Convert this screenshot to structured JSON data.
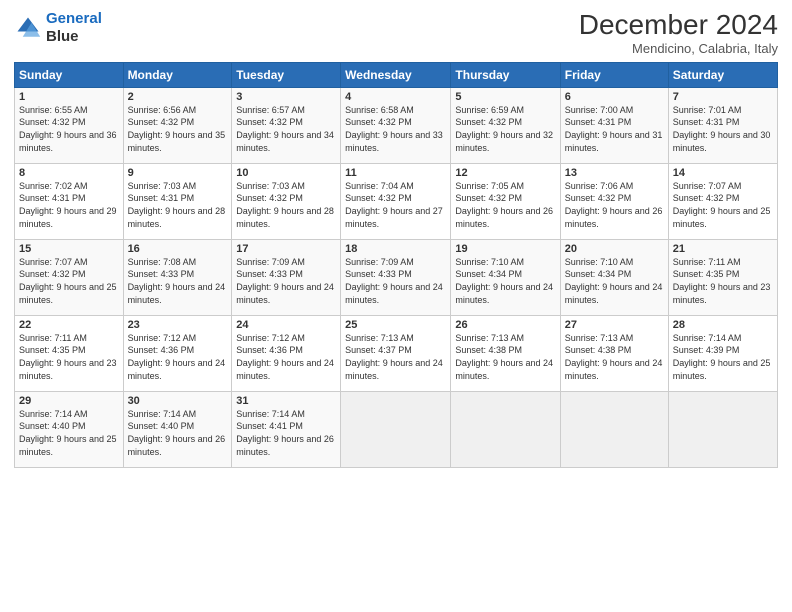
{
  "header": {
    "logo_line1": "General",
    "logo_line2": "Blue",
    "title": "December 2024",
    "subtitle": "Mendicino, Calabria, Italy"
  },
  "weekdays": [
    "Sunday",
    "Monday",
    "Tuesday",
    "Wednesday",
    "Thursday",
    "Friday",
    "Saturday"
  ],
  "weeks": [
    [
      {
        "day": "1",
        "sunrise": "6:55 AM",
        "sunset": "4:32 PM",
        "daylight": "9 hours and 36 minutes."
      },
      {
        "day": "2",
        "sunrise": "6:56 AM",
        "sunset": "4:32 PM",
        "daylight": "9 hours and 35 minutes."
      },
      {
        "day": "3",
        "sunrise": "6:57 AM",
        "sunset": "4:32 PM",
        "daylight": "9 hours and 34 minutes."
      },
      {
        "day": "4",
        "sunrise": "6:58 AM",
        "sunset": "4:32 PM",
        "daylight": "9 hours and 33 minutes."
      },
      {
        "day": "5",
        "sunrise": "6:59 AM",
        "sunset": "4:32 PM",
        "daylight": "9 hours and 32 minutes."
      },
      {
        "day": "6",
        "sunrise": "7:00 AM",
        "sunset": "4:31 PM",
        "daylight": "9 hours and 31 minutes."
      },
      {
        "day": "7",
        "sunrise": "7:01 AM",
        "sunset": "4:31 PM",
        "daylight": "9 hours and 30 minutes."
      }
    ],
    [
      {
        "day": "8",
        "sunrise": "7:02 AM",
        "sunset": "4:31 PM",
        "daylight": "9 hours and 29 minutes."
      },
      {
        "day": "9",
        "sunrise": "7:03 AM",
        "sunset": "4:31 PM",
        "daylight": "9 hours and 28 minutes."
      },
      {
        "day": "10",
        "sunrise": "7:03 AM",
        "sunset": "4:32 PM",
        "daylight": "9 hours and 28 minutes."
      },
      {
        "day": "11",
        "sunrise": "7:04 AM",
        "sunset": "4:32 PM",
        "daylight": "9 hours and 27 minutes."
      },
      {
        "day": "12",
        "sunrise": "7:05 AM",
        "sunset": "4:32 PM",
        "daylight": "9 hours and 26 minutes."
      },
      {
        "day": "13",
        "sunrise": "7:06 AM",
        "sunset": "4:32 PM",
        "daylight": "9 hours and 26 minutes."
      },
      {
        "day": "14",
        "sunrise": "7:07 AM",
        "sunset": "4:32 PM",
        "daylight": "9 hours and 25 minutes."
      }
    ],
    [
      {
        "day": "15",
        "sunrise": "7:07 AM",
        "sunset": "4:32 PM",
        "daylight": "9 hours and 25 minutes."
      },
      {
        "day": "16",
        "sunrise": "7:08 AM",
        "sunset": "4:33 PM",
        "daylight": "9 hours and 24 minutes."
      },
      {
        "day": "17",
        "sunrise": "7:09 AM",
        "sunset": "4:33 PM",
        "daylight": "9 hours and 24 minutes."
      },
      {
        "day": "18",
        "sunrise": "7:09 AM",
        "sunset": "4:33 PM",
        "daylight": "9 hours and 24 minutes."
      },
      {
        "day": "19",
        "sunrise": "7:10 AM",
        "sunset": "4:34 PM",
        "daylight": "9 hours and 24 minutes."
      },
      {
        "day": "20",
        "sunrise": "7:10 AM",
        "sunset": "4:34 PM",
        "daylight": "9 hours and 24 minutes."
      },
      {
        "day": "21",
        "sunrise": "7:11 AM",
        "sunset": "4:35 PM",
        "daylight": "9 hours and 23 minutes."
      }
    ],
    [
      {
        "day": "22",
        "sunrise": "7:11 AM",
        "sunset": "4:35 PM",
        "daylight": "9 hours and 23 minutes."
      },
      {
        "day": "23",
        "sunrise": "7:12 AM",
        "sunset": "4:36 PM",
        "daylight": "9 hours and 24 minutes."
      },
      {
        "day": "24",
        "sunrise": "7:12 AM",
        "sunset": "4:36 PM",
        "daylight": "9 hours and 24 minutes."
      },
      {
        "day": "25",
        "sunrise": "7:13 AM",
        "sunset": "4:37 PM",
        "daylight": "9 hours and 24 minutes."
      },
      {
        "day": "26",
        "sunrise": "7:13 AM",
        "sunset": "4:38 PM",
        "daylight": "9 hours and 24 minutes."
      },
      {
        "day": "27",
        "sunrise": "7:13 AM",
        "sunset": "4:38 PM",
        "daylight": "9 hours and 24 minutes."
      },
      {
        "day": "28",
        "sunrise": "7:14 AM",
        "sunset": "4:39 PM",
        "daylight": "9 hours and 25 minutes."
      }
    ],
    [
      {
        "day": "29",
        "sunrise": "7:14 AM",
        "sunset": "4:40 PM",
        "daylight": "9 hours and 25 minutes."
      },
      {
        "day": "30",
        "sunrise": "7:14 AM",
        "sunset": "4:40 PM",
        "daylight": "9 hours and 26 minutes."
      },
      {
        "day": "31",
        "sunrise": "7:14 AM",
        "sunset": "4:41 PM",
        "daylight": "9 hours and 26 minutes."
      },
      null,
      null,
      null,
      null
    ]
  ]
}
